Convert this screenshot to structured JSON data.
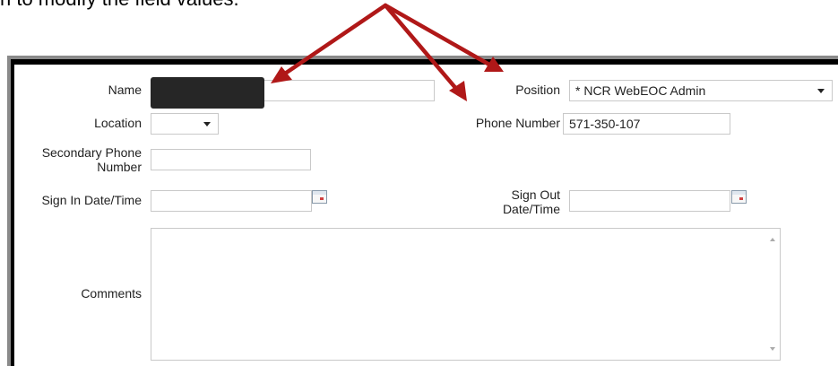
{
  "caption": "n to modify the field values.",
  "form": {
    "name_label": "Name",
    "name_value": "",
    "position_label": "Position",
    "position_value": "* NCR WebEOC Admin",
    "location_label": "Location",
    "location_value": "",
    "phone_label": "Phone Number",
    "phone_value": "571-350-107",
    "secondary_phone_label_line1": "Secondary Phone",
    "secondary_phone_label_line2": "Number",
    "secondary_phone_value": "",
    "sign_in_label": "Sign In Date/Time",
    "sign_in_value": "",
    "sign_out_label_line1": "Sign Out",
    "sign_out_label_line2": "Date/Time",
    "sign_out_value": "",
    "comments_label": "Comments",
    "comments_value": ""
  },
  "icons": {
    "calendar": "calendar-icon",
    "dropdown": "chevron-down-icon"
  },
  "colors": {
    "annotation_arrow": "#b01818",
    "redaction": "#262626"
  }
}
